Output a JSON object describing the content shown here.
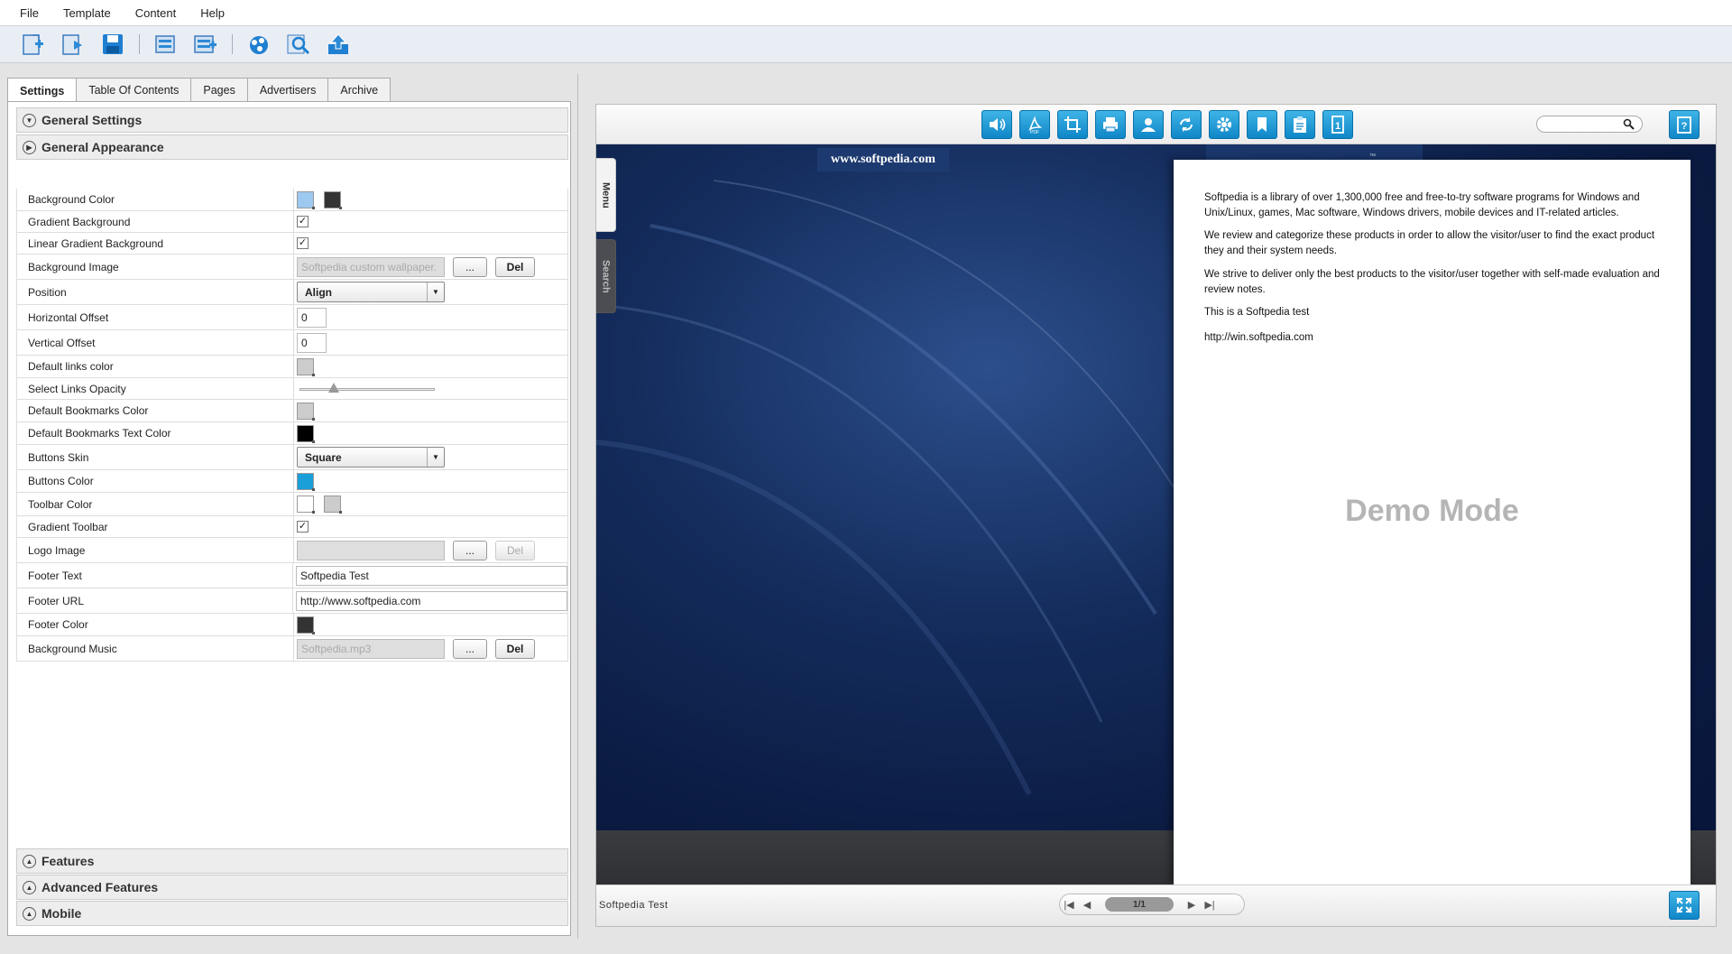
{
  "menu": [
    "File",
    "Template",
    "Content",
    "Help"
  ],
  "toolbar": {
    "icons": [
      "new-project-icon",
      "open-project-icon",
      "save-icon",
      "import-icon",
      "batch-convert-icon",
      "publish-icon",
      "preview-icon",
      "upload-icon"
    ]
  },
  "tabs": [
    "Settings",
    "Table Of Contents",
    "Pages",
    "Advertisers",
    "Archive"
  ],
  "active_tab": "Settings",
  "sections": {
    "general_settings": "General Settings",
    "general_appearance": "General Appearance",
    "features": "Features",
    "advanced_features": "Advanced Features",
    "mobile": "Mobile"
  },
  "props": {
    "background_color": {
      "label": "Background Color",
      "colors": [
        "#9dc8f0",
        "#333333"
      ]
    },
    "gradient_background": {
      "label": "Gradient Background",
      "checked": true
    },
    "linear_gradient_background": {
      "label": "Linear Gradient Background",
      "checked": true
    },
    "background_image": {
      "label": "Background Image",
      "value": "Softpedia custom wallpaper.",
      "browse": "...",
      "del": "Del"
    },
    "position": {
      "label": "Position",
      "value": "Align"
    },
    "horizontal_offset": {
      "label": "Horizontal Offset",
      "value": "0"
    },
    "vertical_offset": {
      "label": "Vertical Offset",
      "value": "0"
    },
    "default_links_color": {
      "label": "Default links color",
      "color": "#cccccc"
    },
    "select_links_opacity": {
      "label": "Select Links Opacity",
      "level": 0.25
    },
    "default_bookmarks_color": {
      "label": "Default Bookmarks Color",
      "color": "#cccccc"
    },
    "default_bookmarks_text_color": {
      "label": "Default Bookmarks Text Color",
      "color": "#000000"
    },
    "buttons_skin": {
      "label": "Buttons Skin",
      "value": "Square"
    },
    "buttons_color": {
      "label": "Buttons Color",
      "color": "#1a9fd9"
    },
    "toolbar_color": {
      "label": "Toolbar Color",
      "colors": [
        "#ffffff",
        "#cccccc"
      ]
    },
    "gradient_toolbar": {
      "label": "Gradient Toolbar",
      "checked": true
    },
    "logo_image": {
      "label": "Logo Image",
      "value": "",
      "browse": "...",
      "del": "Del"
    },
    "footer_text": {
      "label": "Footer Text",
      "value": "Softpedia Test"
    },
    "footer_url": {
      "label": "Footer URL",
      "value": "http://www.softpedia.com"
    },
    "footer_color": {
      "label": "Footer Color",
      "color": "#333333"
    },
    "background_music": {
      "label": "Background Music",
      "value": "Softpedia.mp3",
      "browse": "...",
      "del": "Del"
    }
  },
  "preview": {
    "toolbar_icons": [
      "sound-icon",
      "pdf-icon",
      "crop-icon",
      "print-icon",
      "share-icon",
      "rotate-icon",
      "settings-icon",
      "bookmark-icon",
      "clipboard-icon",
      "single-page-icon"
    ],
    "side_tabs": [
      "Menu",
      "Search"
    ],
    "banner": "www.softpedia.com",
    "tm": "™",
    "page_paragraphs": [
      "Softpedia is a library of over 1,300,000 free and free-to-try software programs for Windows and Unix/Linux, games, Mac software, Windows drivers, mobile devices and IT-related articles.",
      "We review and categorize these products in order to allow the visitor/user to find the exact product they and their system needs.",
      "We strive to deliver only the best products to the visitor/user together with self-made evaluation and review notes.",
      "This is a Softpedia test",
      "http://win.softpedia.com"
    ],
    "demo_mode": "Demo Mode",
    "footer_text": "Softpedia Test",
    "page_indicator": "1/1",
    "accent_color": "#1a9fd9"
  }
}
